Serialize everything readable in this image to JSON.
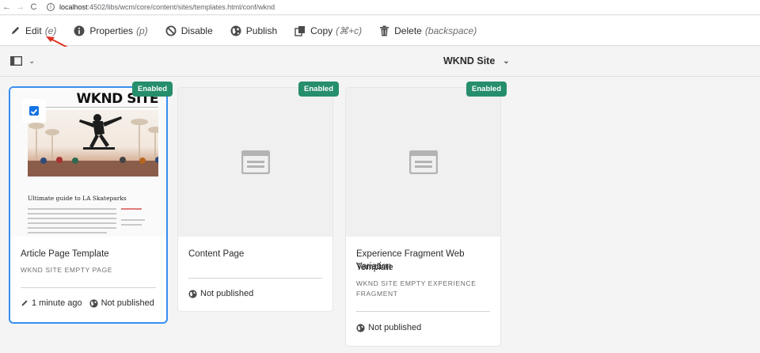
{
  "browser": {
    "url_host": "localhost",
    "url_rest": ":4502/libs/wcm/core/content/sites/templates.html/conf/wknd"
  },
  "actions": [
    {
      "label": "Edit",
      "shortcut": "(e)",
      "icon": "pencil-icon"
    },
    {
      "label": "Properties",
      "shortcut": "(p)",
      "icon": "info-icon"
    },
    {
      "label": "Disable",
      "shortcut": "",
      "icon": "disable-icon"
    },
    {
      "label": "Publish",
      "shortcut": "",
      "icon": "globe-icon"
    },
    {
      "label": "Copy",
      "shortcut": "(⌘+c)",
      "icon": "copy-icon"
    },
    {
      "label": "Delete",
      "shortcut": "(backspace)",
      "icon": "trash-icon"
    }
  ],
  "viewbar": {
    "site_title": "WKND Site"
  },
  "cards": [
    {
      "title": "Article Page Template",
      "subtitle": "WKND SITE EMPTY PAGE",
      "status": "Enabled",
      "modified": "1 minute ago",
      "published": "Not published",
      "selected": true,
      "thumbnail": {
        "heading": "WKND SITE",
        "article_title": "Ultimate guide to LA Skateparks"
      }
    },
    {
      "title": "Content Page",
      "subtitle": "",
      "status": "Enabled",
      "published": "Not published",
      "selected": false
    },
    {
      "title": "Experience Fragment Web Variation Template",
      "title_line1": "Experience Fragment Web Variation",
      "title_line2": "Template",
      "subtitle_line1": "WKND SITE EMPTY EXPERIENCE",
      "subtitle_line2": "FRAGMENT",
      "status": "Enabled",
      "published": "Not published",
      "selected": false
    }
  ],
  "colors": {
    "accent_blue": "#378ef0",
    "enabled_green": "#268e6c",
    "annotation_red": "#e02f20"
  }
}
